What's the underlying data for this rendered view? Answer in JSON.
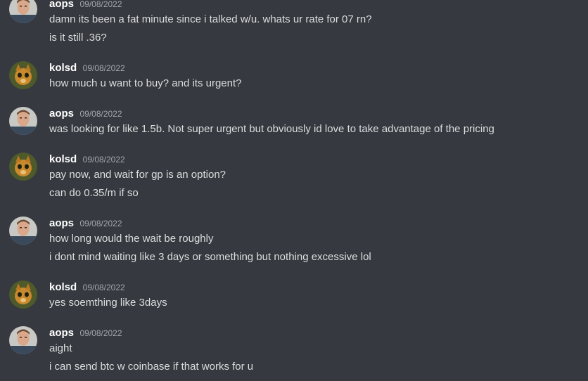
{
  "messages": [
    {
      "author": "aops",
      "timestamp": "09/08/2022",
      "avatar": "aops-avatar",
      "lines": [
        "damn its been a fat minute since i talked w/u. whats ur rate for 07 rn?",
        "is it still .36?"
      ]
    },
    {
      "author": "kolsd",
      "timestamp": "09/08/2022",
      "avatar": "kolsd-avatar",
      "lines": [
        "how much u want to buy? and its urgent?"
      ]
    },
    {
      "author": "aops",
      "timestamp": "09/08/2022",
      "avatar": "aops-avatar",
      "lines": [
        "was looking for like 1.5b. Not super urgent but obviously id love to take advantage of the pricing"
      ]
    },
    {
      "author": "kolsd",
      "timestamp": "09/08/2022",
      "avatar": "kolsd-avatar",
      "lines": [
        "pay now, and wait for gp is an option?",
        "can do 0.35/m if so"
      ]
    },
    {
      "author": "aops",
      "timestamp": "09/08/2022",
      "avatar": "aops-avatar",
      "lines": [
        "how long would the wait be roughly",
        "i dont mind waiting like 3 days or something but nothing excessive lol"
      ]
    },
    {
      "author": "kolsd",
      "timestamp": "09/08/2022",
      "avatar": "kolsd-avatar",
      "lines": [
        "yes soemthing like 3days"
      ]
    },
    {
      "author": "aops",
      "timestamp": "09/08/2022",
      "avatar": "aops-avatar",
      "lines": [
        "aight",
        "i can send btc w coinbase if that works for u"
      ]
    }
  ],
  "colors": {
    "background": "#36393f",
    "username": "#ffffff",
    "timestamp": "#a3a6aa",
    "message_text": "#dcddde"
  }
}
